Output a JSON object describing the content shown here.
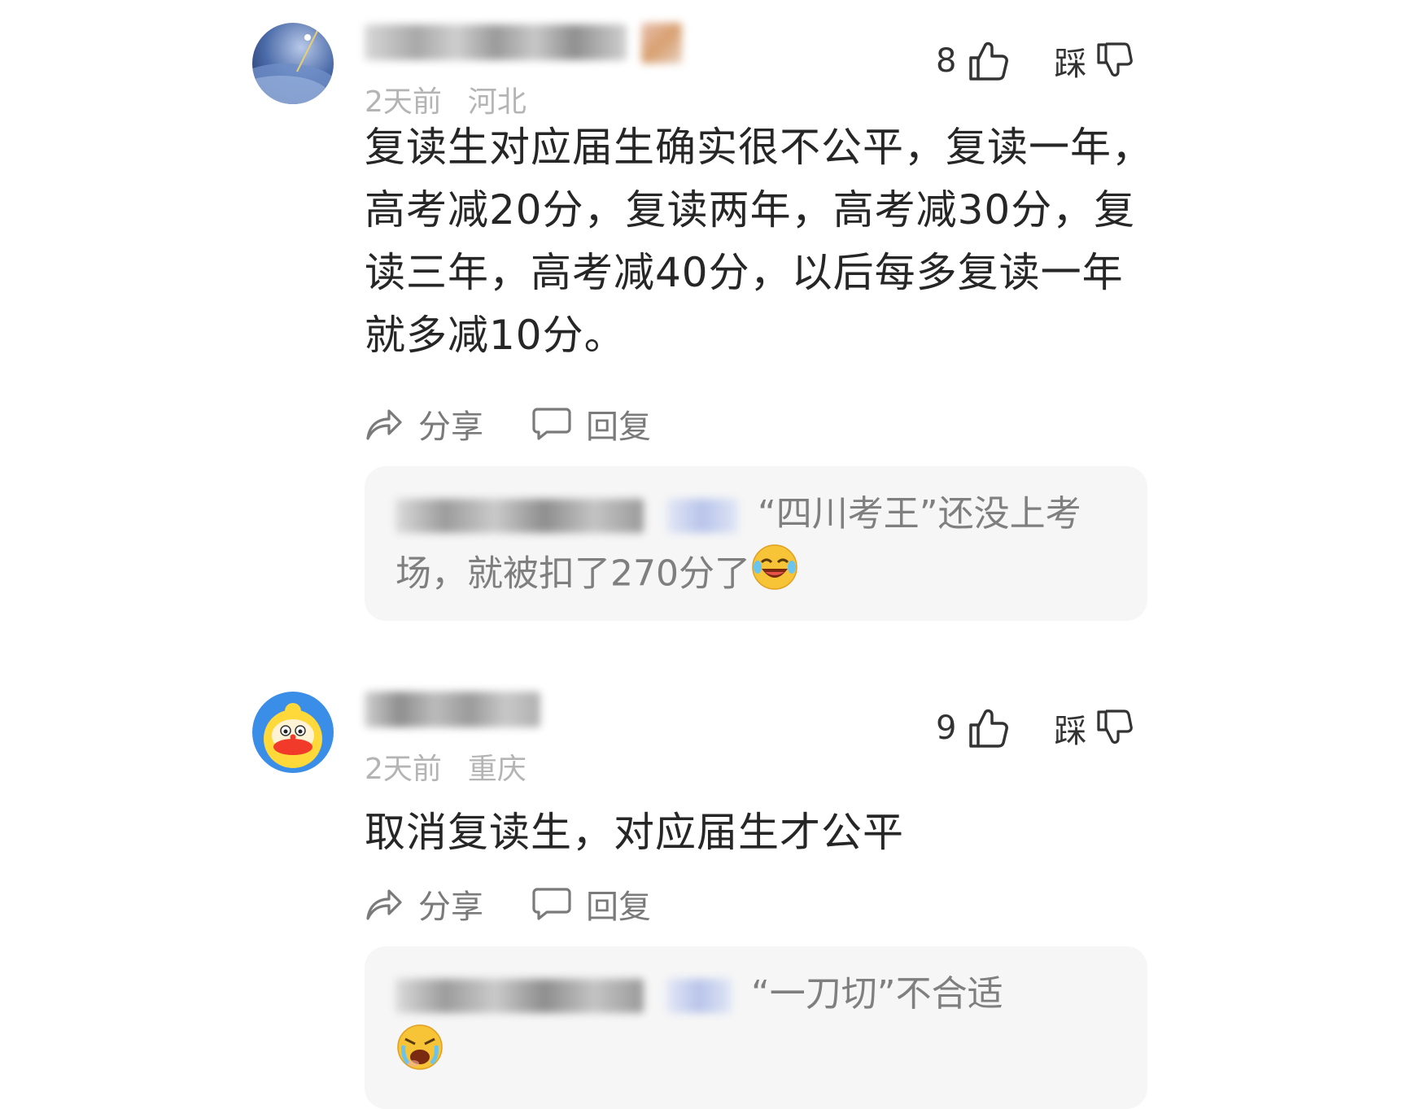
{
  "comments": [
    {
      "avatar_icon": "earth-orbit-avatar",
      "username_hidden": true,
      "time": "2天前",
      "location": "河北",
      "like_count": "8",
      "tread_label": "踩",
      "text": "复读生对应届生确实很不公平，复读一年，高考减20分，复读两年，高考减30分，复读三年，高考减40分，以后每多复读一年就多减10分。",
      "actions": {
        "share": "分享",
        "reply": "回复"
      },
      "reply_preview": {
        "text": "“四川考王”还没上考场，就被扣了270分了",
        "emoji": "laughing-tears-emoji"
      }
    },
    {
      "avatar_icon": "yellow-cartoon-avatar",
      "username_hidden": true,
      "time": "2天前",
      "location": "重庆",
      "like_count": "9",
      "tread_label": "踩",
      "text": "取消复读生，对应届生才公平",
      "actions": {
        "share": "分享",
        "reply": "回复"
      },
      "reply_preview": {
        "text": "“一刀切”不合适",
        "emoji": "crying-emoji"
      }
    }
  ],
  "colors": {
    "meta_gray": "#b4b4b4",
    "reply_bg": "#f6f6f6",
    "reply_text": "#7f7f7f",
    "body_text": "#262626"
  }
}
